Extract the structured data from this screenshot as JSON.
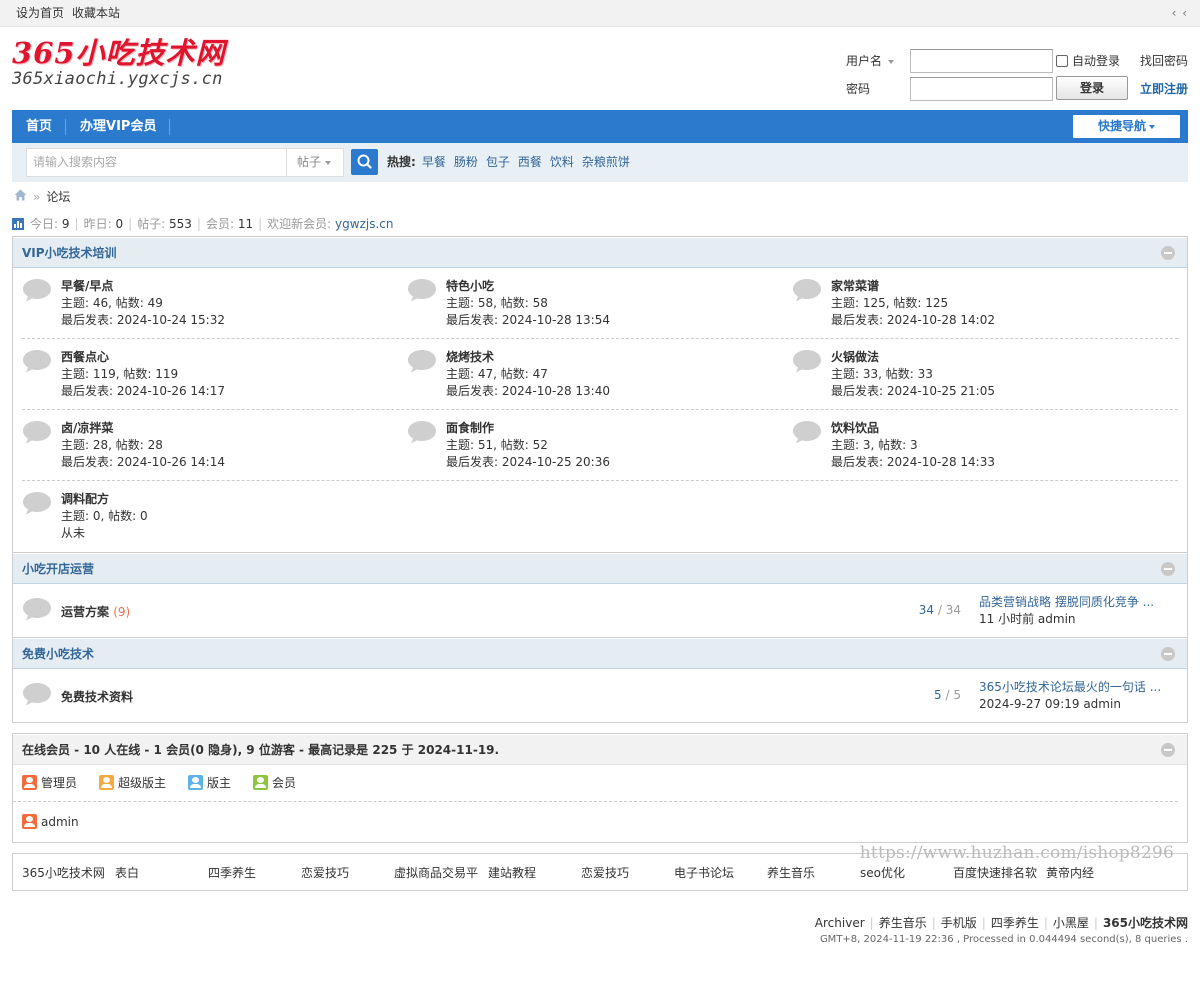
{
  "topbar": {
    "set_home": "设为首页",
    "bookmark": "收藏本站",
    "toggle": "‹ ‹"
  },
  "header": {
    "logo_line1": "365小吃技术网",
    "logo_line2": "365xiaochi.ygxcjs.cn",
    "login": {
      "username_label": "用户名",
      "password_label": "密码",
      "auto_login": "自动登录",
      "login_button": "登录",
      "forgot_password": "找回密码",
      "register": "立即注册"
    }
  },
  "nav": {
    "items": [
      "首页",
      "办理VIP会员"
    ],
    "quick_nav": "快捷导航"
  },
  "search": {
    "placeholder": "请输入搜索内容",
    "type": "帖子",
    "hot_label": "热搜:",
    "hot_words": [
      "早餐",
      "肠粉",
      "包子",
      "西餐",
      "饮料",
      "杂粮煎饼"
    ]
  },
  "breadcrumb": {
    "current": "论坛",
    "sep": "»"
  },
  "stats": {
    "today_label": "今日:",
    "today": "9",
    "yesterday_label": "昨日:",
    "yesterday": "0",
    "posts_label": "帖子:",
    "posts": "553",
    "members_label": "会员:",
    "members": "11",
    "welcome_label": "欢迎新会员:",
    "new_member": "ygwzjs.cn"
  },
  "categories": [
    {
      "title": "VIP小吃技术培训",
      "forums": [
        {
          "name": "早餐/早点",
          "stats": "主题: 46, 帖数: 49",
          "last": "最后发表: 2024-10-24 15:32"
        },
        {
          "name": "特色小吃",
          "stats": "主题: 58, 帖数: 58",
          "last": "最后发表: 2024-10-28 13:54"
        },
        {
          "name": "家常菜谱",
          "stats": "主题: 125, 帖数: 125",
          "last": "最后发表: 2024-10-28 14:02"
        },
        {
          "name": "西餐点心",
          "stats": "主题: 119, 帖数: 119",
          "last": "最后发表: 2024-10-26 14:17"
        },
        {
          "name": "烧烤技术",
          "stats": "主题: 47, 帖数: 47",
          "last": "最后发表: 2024-10-28 13:40"
        },
        {
          "name": "火锅做法",
          "stats": "主题: 33, 帖数: 33",
          "last": "最后发表: 2024-10-25 21:05"
        },
        {
          "name": "卤/凉拌菜",
          "stats": "主题: 28, 帖数: 28",
          "last": "最后发表: 2024-10-26 14:14"
        },
        {
          "name": "面食制作",
          "stats": "主题: 51, 帖数: 52",
          "last": "最后发表: 2024-10-25 20:36"
        },
        {
          "name": "饮料饮品",
          "stats": "主题: 3, 帖数: 3",
          "last": "最后发表: 2024-10-28 14:33"
        },
        {
          "name": "调料配方",
          "stats": "主题: 0, 帖数: 0",
          "last": "从未"
        }
      ]
    },
    {
      "title": "小吃开店运营",
      "forum": {
        "name": "运营方案",
        "today_count": "(9)",
        "threads": "34",
        "posts": "34",
        "last_title": "品类营销战略 摆脱同质化竞争 ...",
        "last_time": "11 小时前",
        "last_user": "admin"
      }
    },
    {
      "title": "免费小吃技术",
      "forum": {
        "name": "免费技术资料",
        "today_count": "",
        "threads": "5",
        "posts": "5",
        "last_title": "365小吃技术论坛最火的一句话 ...",
        "last_time": "2024-9-27 09:19",
        "last_user": "admin"
      }
    }
  ],
  "online": {
    "title": "在线会员 - 10 人在线 - 1 会员(0 隐身), 9 位游客 - 最高记录是 225 于 2024-11-19.",
    "legend": [
      {
        "label": "管理员",
        "color": "#f26a3d"
      },
      {
        "label": "超级版主",
        "color": "#f5a941"
      },
      {
        "label": "版主",
        "color": "#5fb2e8"
      },
      {
        "label": "会员",
        "color": "#8cc63e"
      }
    ],
    "users": [
      "admin"
    ]
  },
  "friend_links": [
    "365小吃技术网",
    "表白",
    "四季养生",
    "恋爱技巧",
    "虚拟商品交易平",
    "建站教程",
    "恋爱技巧",
    "电子书论坛",
    "养生音乐",
    "seo优化",
    "百度快速排名软",
    "黄帝内经"
  ],
  "watermark": "https://www.huzhan.com/ishop8296",
  "footer": {
    "links": [
      "Archiver",
      "养生音乐",
      "手机版",
      "四季养生",
      "小黑屋"
    ],
    "site_name": "365小吃技术网",
    "info": "GMT+8, 2024-11-19 22:36 , Processed in 0.044494 second(s), 8 queries ."
  },
  "colors": {
    "nav_blue": "#2b7acd",
    "link_blue": "#336699",
    "logo_red": "#e0142d",
    "header_bg": "#e5edf2"
  }
}
